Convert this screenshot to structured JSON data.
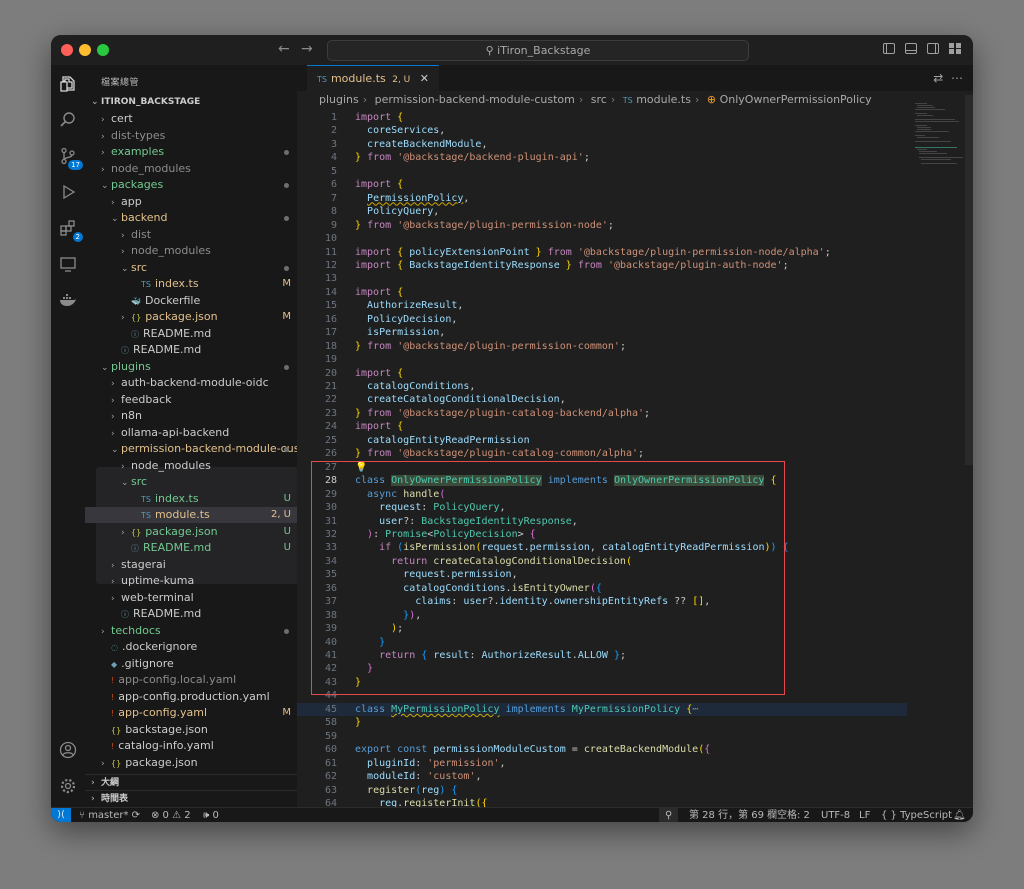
{
  "window": {
    "title": "iTiron_Backstage"
  },
  "activity": {
    "scm_badge": "17",
    "ext_badge": "2"
  },
  "explorer": {
    "header": "檔案總管",
    "root": "ITIRON_BACKSTAGE",
    "outline": "大綱",
    "timeline": "時間表"
  },
  "tree": [
    {
      "label": "cert",
      "chev": "›",
      "indent": 1,
      "color": "#cccccc",
      "icon": "",
      "status": ""
    },
    {
      "label": "dist-types",
      "chev": "›",
      "indent": 1,
      "color": "#8c8c8c",
      "icon": "",
      "status": ""
    },
    {
      "label": "examples",
      "chev": "›",
      "indent": 1,
      "color": "#73c991",
      "icon": "",
      "status": "dot"
    },
    {
      "label": "node_modules",
      "chev": "›",
      "indent": 1,
      "color": "#8c8c8c",
      "icon": "",
      "status": ""
    },
    {
      "label": "packages",
      "chev": "⌄",
      "indent": 1,
      "color": "#73c991",
      "icon": "",
      "status": "dot"
    },
    {
      "label": "app",
      "chev": "›",
      "indent": 2,
      "color": "#cccccc",
      "icon": "",
      "status": ""
    },
    {
      "label": "backend",
      "chev": "⌄",
      "indent": 2,
      "color": "#e2c08d",
      "icon": "",
      "status": "dot"
    },
    {
      "label": "dist",
      "chev": "›",
      "indent": 3,
      "color": "#8c8c8c",
      "icon": "",
      "status": ""
    },
    {
      "label": "node_modules",
      "chev": "›",
      "indent": 3,
      "color": "#8c8c8c",
      "icon": "",
      "status": ""
    },
    {
      "label": "src",
      "chev": "⌄",
      "indent": 3,
      "color": "#e2c08d",
      "icon": "",
      "status": "dot"
    },
    {
      "label": "index.ts",
      "chev": "",
      "indent": 4,
      "color": "#e2c08d",
      "icon": "TS",
      "status": "M"
    },
    {
      "label": "Dockerfile",
      "chev": "",
      "indent": 3,
      "color": "#cccccc",
      "icon": "🐳",
      "status": ""
    },
    {
      "label": "package.json",
      "chev": "›",
      "indent": 3,
      "color": "#e2c08d",
      "icon": "{}",
      "status": "M"
    },
    {
      "label": "README.md",
      "chev": "",
      "indent": 3,
      "color": "#cccccc",
      "icon": "ⓘ",
      "status": ""
    },
    {
      "label": "README.md",
      "chev": "",
      "indent": 2,
      "color": "#cccccc",
      "icon": "ⓘ",
      "status": ""
    },
    {
      "label": "plugins",
      "chev": "⌄",
      "indent": 1,
      "color": "#73c991",
      "icon": "",
      "status": "dot"
    },
    {
      "label": "auth-backend-module-oidc",
      "chev": "›",
      "indent": 2,
      "color": "#cccccc",
      "icon": "",
      "status": ""
    },
    {
      "label": "feedback",
      "chev": "›",
      "indent": 2,
      "color": "#cccccc",
      "icon": "",
      "status": ""
    },
    {
      "label": "n8n",
      "chev": "›",
      "indent": 2,
      "color": "#cccccc",
      "icon": "",
      "status": ""
    },
    {
      "label": "ollama-api-backend",
      "chev": "›",
      "indent": 2,
      "color": "#cccccc",
      "icon": "",
      "status": ""
    },
    {
      "label": "permission-backend-module-cus...",
      "chev": "⌄",
      "indent": 2,
      "color": "#e2c08d",
      "icon": "",
      "status": "dot"
    },
    {
      "label": "node_modules",
      "chev": "›",
      "indent": 3,
      "color": "#cccccc",
      "icon": "",
      "status": ""
    },
    {
      "label": "src",
      "chev": "⌄",
      "indent": 3,
      "color": "#73c991",
      "icon": "",
      "status": ""
    },
    {
      "label": "index.ts",
      "chev": "",
      "indent": 4,
      "color": "#73c991",
      "icon": "TS",
      "status": "U"
    },
    {
      "label": "module.ts",
      "chev": "",
      "indent": 4,
      "color": "#e2c08d",
      "icon": "TS",
      "status": "2, U"
    },
    {
      "label": "package.json",
      "chev": "›",
      "indent": 3,
      "color": "#73c991",
      "icon": "{}",
      "status": "U"
    },
    {
      "label": "README.md",
      "chev": "",
      "indent": 3,
      "color": "#73c991",
      "icon": "ⓘ",
      "status": "U"
    },
    {
      "label": "stagerai",
      "chev": "›",
      "indent": 2,
      "color": "#cccccc",
      "icon": "",
      "status": ""
    },
    {
      "label": "uptime-kuma",
      "chev": "›",
      "indent": 2,
      "color": "#cccccc",
      "icon": "",
      "status": ""
    },
    {
      "label": "web-terminal",
      "chev": "›",
      "indent": 2,
      "color": "#cccccc",
      "icon": "",
      "status": ""
    },
    {
      "label": "README.md",
      "chev": "",
      "indent": 2,
      "color": "#cccccc",
      "icon": "ⓘ",
      "status": ""
    },
    {
      "label": "techdocs",
      "chev": "›",
      "indent": 1,
      "color": "#73c991",
      "icon": "",
      "status": "dot"
    },
    {
      "label": ".dockerignore",
      "chev": "",
      "indent": 1,
      "color": "#cccccc",
      "icon": "◌",
      "status": ""
    },
    {
      "label": ".gitignore",
      "chev": "",
      "indent": 1,
      "color": "#cccccc",
      "icon": "◆",
      "status": ""
    },
    {
      "label": "app-config.local.yaml",
      "chev": "",
      "indent": 1,
      "color": "#8c8c8c",
      "icon": "!",
      "status": ""
    },
    {
      "label": "app-config.production.yaml",
      "chev": "",
      "indent": 1,
      "color": "#cccccc",
      "icon": "!",
      "status": ""
    },
    {
      "label": "app-config.yaml",
      "chev": "",
      "indent": 1,
      "color": "#e2c08d",
      "icon": "!",
      "status": "M"
    },
    {
      "label": "backstage.json",
      "chev": "",
      "indent": 1,
      "color": "#cccccc",
      "icon": "{}",
      "status": ""
    },
    {
      "label": "catalog-info.yaml",
      "chev": "",
      "indent": 1,
      "color": "#cccccc",
      "icon": "!",
      "status": ""
    },
    {
      "label": "package.json",
      "chev": "›",
      "indent": 1,
      "color": "#cccccc",
      "icon": "{}",
      "status": ""
    }
  ],
  "editor": {
    "tab_label": "module.ts",
    "tab_status": "2, U",
    "breadcrumb": [
      "plugins",
      "permission-backend-module-custom",
      "src",
      "module.ts",
      "OnlyOwnerPermissionPolicy"
    ],
    "lines": [
      {
        "n": "1",
        "html": "<span class=\"c\">import</span> <span class=\"b\">{</span>"
      },
      {
        "n": "2",
        "html": "  <span class=\"v\">coreServices</span>,"
      },
      {
        "n": "3",
        "html": "  <span class=\"v\">createBackendModule</span>,"
      },
      {
        "n": "4",
        "html": "<span class=\"b\">}</span> <span class=\"c\">from</span> <span class=\"s\">'@backstage/backend-plugin-api'</span>;"
      },
      {
        "n": "5",
        "html": ""
      },
      {
        "n": "6",
        "html": "<span class=\"c\">import</span> <span class=\"b\">{</span>"
      },
      {
        "n": "7",
        "html": "  <span class=\"v sq\">PermissionPolicy</span>,"
      },
      {
        "n": "8",
        "html": "  <span class=\"v\">PolicyQuery</span>,"
      },
      {
        "n": "9",
        "html": "<span class=\"b\">}</span> <span class=\"c\">from</span> <span class=\"s\">'@backstage/plugin-permission-node'</span>;"
      },
      {
        "n": "10",
        "html": ""
      },
      {
        "n": "11",
        "html": "<span class=\"c\">import</span> <span class=\"b\">{</span> <span class=\"v\">policyExtensionPoint</span> <span class=\"b\">}</span> <span class=\"c\">from</span> <span class=\"s\">'@backstage/plugin-permission-node/alpha'</span>;"
      },
      {
        "n": "12",
        "html": "<span class=\"c\">import</span> <span class=\"b\">{</span> <span class=\"v\">BackstageIdentityResponse</span> <span class=\"b\">}</span> <span class=\"c\">from</span> <span class=\"s\">'@backstage/plugin-auth-node'</span>;"
      },
      {
        "n": "13",
        "html": ""
      },
      {
        "n": "14",
        "html": "<span class=\"c\">import</span> <span class=\"b\">{</span>"
      },
      {
        "n": "15",
        "html": "  <span class=\"v\">AuthorizeResult</span>,"
      },
      {
        "n": "16",
        "html": "  <span class=\"v\">PolicyDecision</span>,"
      },
      {
        "n": "17",
        "html": "  <span class=\"v\">isPermission</span>,"
      },
      {
        "n": "18",
        "html": "<span class=\"b\">}</span> <span class=\"c\">from</span> <span class=\"s\">'@backstage/plugin-permission-common'</span>;"
      },
      {
        "n": "19",
        "html": ""
      },
      {
        "n": "20",
        "html": "<span class=\"c\">import</span> <span class=\"b\">{</span>"
      },
      {
        "n": "21",
        "html": "  <span class=\"v\">catalogConditions</span>,"
      },
      {
        "n": "22",
        "html": "  <span class=\"v\">createCatalogConditionalDecision</span>,"
      },
      {
        "n": "23",
        "html": "<span class=\"b\">}</span> <span class=\"c\">from</span> <span class=\"s\">'@backstage/plugin-catalog-backend/alpha'</span>;"
      },
      {
        "n": "24",
        "html": "<span class=\"c\">import</span> <span class=\"b\">{</span>"
      },
      {
        "n": "25",
        "html": "  <span class=\"v\">catalogEntityReadPermission</span>"
      },
      {
        "n": "26",
        "html": "<span class=\"b\">}</span> <span class=\"c\">from</span> <span class=\"s\">'@backstage/plugin-catalog-common/alpha'</span>;"
      },
      {
        "n": "27",
        "html": "<span class=\"b\">💡</span>"
      },
      {
        "n": "28",
        "html": "<span class=\"k\">class</span> <span class=\"t hl\">OnlyOwnerPermissionPolicy</span> <span class=\"k\">implements</span> <span class=\"t hl\">OnlyOwnerPermissionPolicy</span> <span class=\"b\">{</span>",
        "cur": true
      },
      {
        "n": "29",
        "html": "  <span class=\"k\">async</span> <span class=\"f\">handle</span><span class=\"p\">(</span>"
      },
      {
        "n": "30",
        "html": "    <span class=\"v\">request</span>: <span class=\"t\">PolicyQuery</span>,"
      },
      {
        "n": "31",
        "html": "    <span class=\"v\">user</span>?: <span class=\"t\">BackstageIdentityResponse</span>,"
      },
      {
        "n": "32",
        "html": "  <span class=\"p\">)</span>: <span class=\"t\">Promise</span>&lt;<span class=\"t\">PolicyDecision</span>&gt; <span class=\"p\">{</span>"
      },
      {
        "n": "33",
        "html": "    <span class=\"c\">if</span> <span class=\"bl\">(</span><span class=\"f\">isPermission</span><span class=\"b\">(</span><span class=\"v\">request</span>.<span class=\"v\">permission</span>, <span class=\"v\">catalogEntityReadPermission</span><span class=\"b\">)</span><span class=\"bl\">)</span> <span class=\"bl\">{</span>"
      },
      {
        "n": "34",
        "html": "      <span class=\"c\">return</span> <span class=\"f\">createCatalogConditionalDecision</span><span class=\"b\">(</span>"
      },
      {
        "n": "35",
        "html": "        <span class=\"v\">request</span>.<span class=\"v\">permission</span>,"
      },
      {
        "n": "36",
        "html": "        <span class=\"v\">catalogConditions</span>.<span class=\"f\">isEntityOwner</span><span class=\"p\">(</span><span class=\"bl\">{</span>"
      },
      {
        "n": "37",
        "html": "          <span class=\"v\">claims</span>: <span class=\"v\">user</span>?.<span class=\"v\">identity</span>.<span class=\"v\">ownershipEntityRefs</span> ?? <span class=\"b\">[]</span>,"
      },
      {
        "n": "38",
        "html": "        <span class=\"bl\">}</span><span class=\"p\">)</span>,"
      },
      {
        "n": "39",
        "html": "      <span class=\"b\">)</span>;"
      },
      {
        "n": "40",
        "html": "    <span class=\"bl\">}</span>"
      },
      {
        "n": "41",
        "html": "    <span class=\"c\">return</span> <span class=\"bl\">{</span> <span class=\"v\">result</span>: <span class=\"v\">AuthorizeResult</span>.<span class=\"v\">ALLOW</span> <span class=\"bl\">}</span>;"
      },
      {
        "n": "42",
        "html": "  <span class=\"p\">}</span>"
      },
      {
        "n": "43",
        "html": "<span class=\"b\">}</span>"
      },
      {
        "n": "44",
        "html": ""
      },
      {
        "n": "45",
        "html": "<span class=\"k\">class</span> <span class=\"t sq\">MyPermissionPolicy</span> <span class=\"k\">implements</span> <span class=\"t\">MyPermissionPolicy</span> <span class=\"b\">{</span><span style=\"color:#888\">⋯</span>"
      },
      {
        "n": "58",
        "html": "<span class=\"b\">}</span>"
      },
      {
        "n": "59",
        "html": ""
      },
      {
        "n": "60",
        "html": "<span class=\"k\">export</span> <span class=\"k\">const</span> <span class=\"v\">permissionModuleCustom</span> = <span class=\"f\">createBackendModule</span><span class=\"b\">(</span><span class=\"p\">{</span>"
      },
      {
        "n": "61",
        "html": "  <span class=\"v\">pluginId</span>: <span class=\"s\">'permission'</span>,"
      },
      {
        "n": "62",
        "html": "  <span class=\"v\">moduleId</span>: <span class=\"s\">'custom'</span>,"
      },
      {
        "n": "63",
        "html": "  <span class=\"f\">register</span><span class=\"bl\">(</span><span class=\"v\">reg</span><span class=\"bl\">)</span> <span class=\"bl\">{</span>"
      },
      {
        "n": "64",
        "html": "    <span class=\"v\">reg</span>.<span class=\"f\">registerInit</span><span class=\"b\">({</span>"
      }
    ]
  },
  "statusbar": {
    "branch": "master*",
    "problems": "⊗ 0 ⚠ 2",
    "ports": "🕪 0",
    "position": "第 28 行，第 69 欄",
    "spaces": "空格: 2",
    "encoding": "UTF-8",
    "eol": "LF",
    "language": "{ } TypeScript"
  }
}
